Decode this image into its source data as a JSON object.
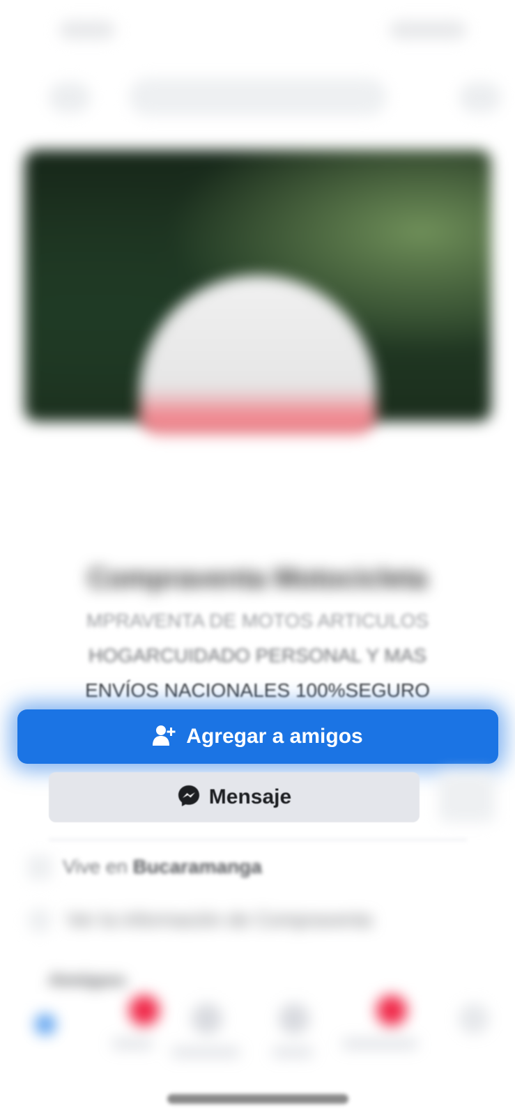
{
  "profile": {
    "name": "Compraventa Motocicleta",
    "bio_line1": "MPRAVENTA DE MOTOS ARTICULOS",
    "bio_line2": "HOGARCUIDADO PERSONAL Y MAS",
    "bio_line3": "ENVÍOS NACIONALES 100%SEGURO"
  },
  "actions": {
    "add_friend_label": "Agregar a amigos",
    "add_friend_icon": "add-person-icon",
    "message_label": "Mensaje",
    "message_icon": "messenger-icon",
    "accent_color": "#1b74e4"
  },
  "details": {
    "lives_in_prefix": "Vive en",
    "lives_in_city": "Bucaramanga",
    "more_info_text": "Ver la información de Compraventa"
  },
  "sections": {
    "friends_heading": "Amigos"
  }
}
